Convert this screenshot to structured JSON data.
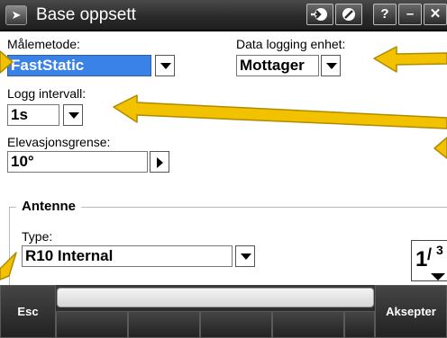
{
  "titlebar": {
    "app_icon": "trimble-run-icon",
    "title": "Base oppsett",
    "buttons": [
      "forward-icon",
      "stop-icon",
      "help-icon",
      "minimize-icon",
      "close-icon"
    ],
    "help_label": "?",
    "minimize_label": "–",
    "close_label": "✕"
  },
  "form": {
    "malemetode": {
      "label": "Målemetode:",
      "value": "FastStatic"
    },
    "data_logging": {
      "label": "Data logging enhet:",
      "value": "Mottager"
    },
    "logg_intervall": {
      "label": "Logg intervall:",
      "value": "1s"
    },
    "elevasjonsgrense": {
      "label": "Elevasjonsgrense:",
      "value": "10°"
    }
  },
  "antenne": {
    "group_title": "Antenne",
    "type_label": "Type:",
    "type_value": "R10 Internal"
  },
  "pager": {
    "current": "1",
    "total": "3"
  },
  "softkeys": {
    "esc": "Esc",
    "accept": "Aksepter"
  },
  "colors": {
    "selection": "#3a82e8",
    "arrow": "#f2c200",
    "titlebar": "#2b2b2b"
  }
}
